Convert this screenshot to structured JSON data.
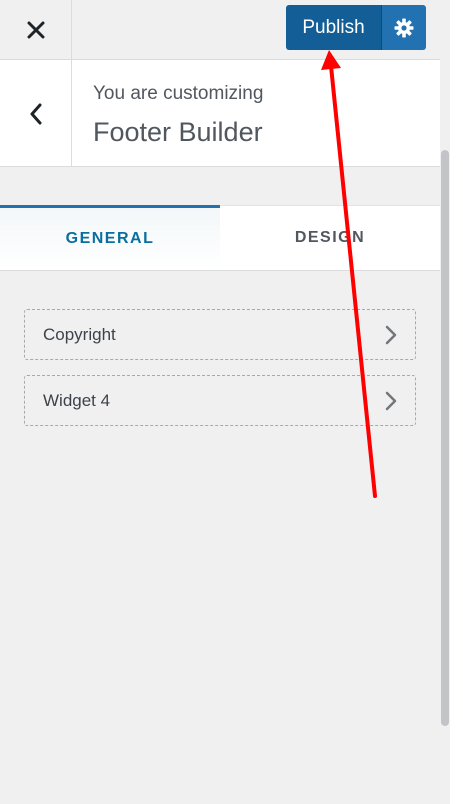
{
  "topbar": {
    "close_icon": "close-icon",
    "publish_label": "Publish",
    "settings_icon": "gear-icon"
  },
  "section": {
    "customizing_label": "You are customizing",
    "title": "Footer Builder",
    "back_icon": "chevron-left-icon"
  },
  "tabs": [
    {
      "label": "GENERAL",
      "active": true
    },
    {
      "label": "DESIGN",
      "active": false
    }
  ],
  "items": [
    {
      "label": "Copyright",
      "icon": "chevron-right-icon"
    },
    {
      "label": "Widget 4",
      "icon": "chevron-right-icon"
    }
  ],
  "colors": {
    "accent": "#2271b1",
    "publish_bg": "#135e96",
    "annotation_arrow": "#ff0000"
  }
}
